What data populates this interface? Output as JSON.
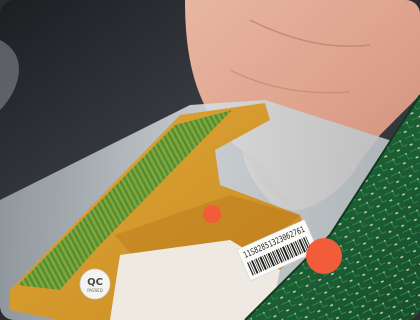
{
  "photo": {
    "qc_label": {
      "main": "QC",
      "sub": "PASSED"
    },
    "serial_label": {
      "serial": "11S82851323062761"
    },
    "colors": {
      "background": "#2a2c31",
      "skin": "#e3ad97",
      "flex_cable": "#d79a2a",
      "pcb_green": "#1f6b3a",
      "dot_orange": "#f25c39"
    }
  }
}
